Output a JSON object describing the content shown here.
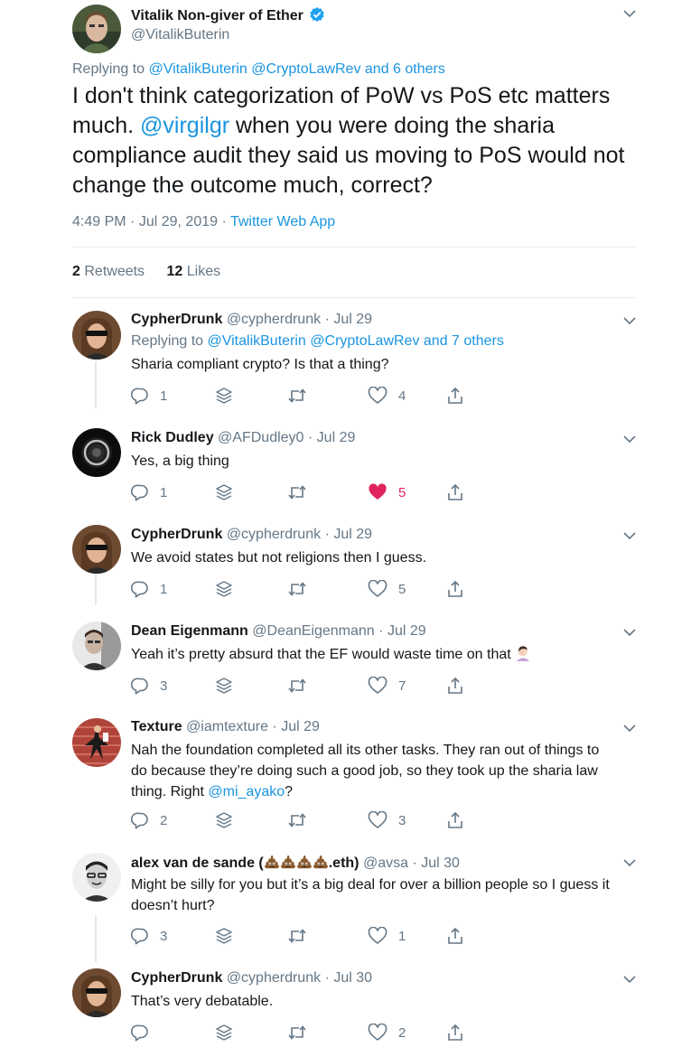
{
  "main_tweet": {
    "author_name": "Vitalik Non-giver of Ether",
    "author_handle": "@VitalikButerin",
    "replying_to_prefix": "Replying to",
    "replying_to_1": "@VitalikButerin",
    "replying_to_2": "@CryptoLawRev",
    "replying_to_more": "and 6 others",
    "text_part1": "I don't think categorization of PoW vs PoS etc matters much.",
    "mention": "@virgilgr",
    "text_part2": "when you were doing the sharia compliance audit they said us moving to PoS would not change the outcome much, correct?",
    "time": "4:49 PM",
    "date": "Jul 29, 2019",
    "source": "Twitter Web App",
    "retweets_count": "2",
    "retweets_label": "Retweets",
    "likes_count": "12",
    "likes_label": "Likes"
  },
  "replies": [
    {
      "name": "CypherDrunk",
      "handle": "@cypherdrunk",
      "date": "Jul 29",
      "replying_to_prefix": "Replying to",
      "replying_to_1": "@VitalikButerin",
      "replying_to_2": "@CryptoLawRev",
      "replying_to_more": "and 7 others",
      "text": "Sharia compliant crypto? Is that a thing?",
      "reply_count": "1",
      "retweet_count": "",
      "like_count": "4"
    },
    {
      "name": "Rick Dudley",
      "handle": "@AFDudley0",
      "date": "Jul 29",
      "text": "Yes, a big thing",
      "reply_count": "1",
      "retweet_count": "",
      "like_count": "5"
    },
    {
      "name": "CypherDrunk",
      "handle": "@cypherdrunk",
      "date": "Jul 29",
      "text": "We avoid states but not religions then I guess.",
      "reply_count": "1",
      "retweet_count": "",
      "like_count": "5"
    },
    {
      "name": "Dean Eigenmann",
      "handle": "@DeanEigenmann",
      "date": "Jul 29",
      "text": "Yeah it’s pretty absurd that the EF would waste time on that",
      "reply_count": "3",
      "retweet_count": "",
      "like_count": "7"
    },
    {
      "name": "Texture",
      "handle": "@iamtexture",
      "date": "Jul 29",
      "text_line1": "Nah the foundation completed all its other tasks. They ran out of things to",
      "text_line2": "do because they’re doing such a good job, so they took up the sharia law",
      "text_line3_prefix": "thing. Right",
      "mention": "@mi_ayako",
      "text_line3_suffix": "?",
      "reply_count": "2",
      "retweet_count": "",
      "like_count": "3"
    },
    {
      "name_prefix": "alex van de sande (",
      "name_suffix": ".eth)",
      "handle": "@avsa",
      "date": "Jul 30",
      "text_line1": "Might be silly for you but it’s a big deal for over a billion people so I guess it",
      "text_line2": "doesn’t hurt?",
      "reply_count": "3",
      "retweet_count": "",
      "like_count": "1"
    },
    {
      "name": "CypherDrunk",
      "handle": "@cypherdrunk",
      "date": "Jul 30",
      "text": "That’s very debatable.",
      "reply_count": "",
      "retweet_count": "",
      "like_count": "2"
    }
  ],
  "separator": "·",
  "icons": {
    "verified": "verified-badge-icon",
    "chevron": "chevron-down-icon",
    "reply": "reply-bubble-icon",
    "stack": "layers-icon",
    "retweet": "retweet-icon",
    "like": "heart-icon",
    "share": "share-icon",
    "emoji_poop": "pile-of-poo-emoji",
    "emoji_facepalm": "facepalm-emoji"
  },
  "colors": {
    "link": "#1b95e0",
    "liked": "#e0245e",
    "muted": "#657786",
    "verified": "#1da1f2"
  }
}
